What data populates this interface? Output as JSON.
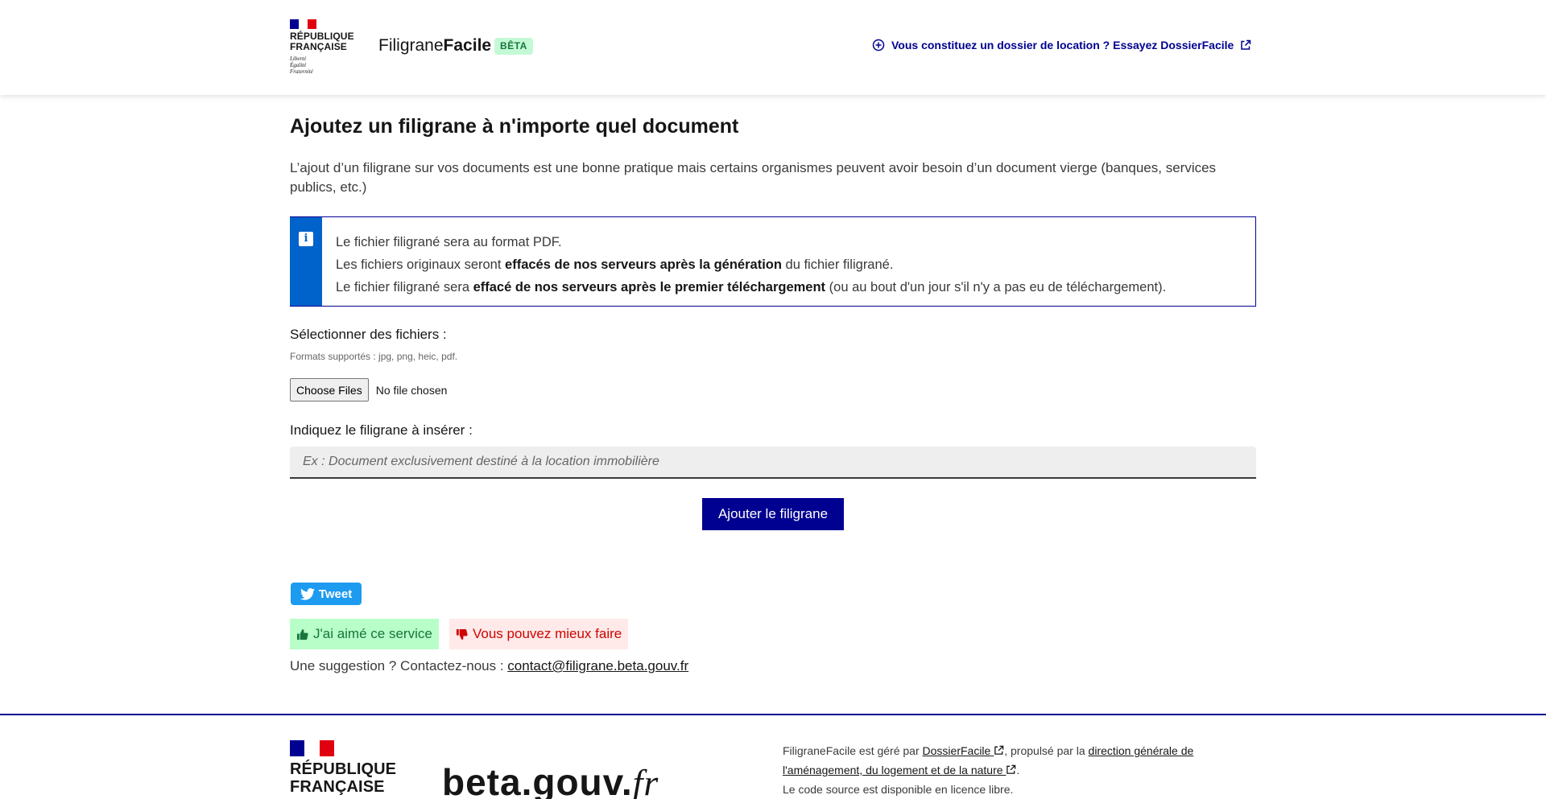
{
  "header": {
    "republic_name_line1": "RÉPUBLIQUE",
    "republic_name_line2": "FRANÇAISE",
    "motto_line1": "Liberté",
    "motto_line2": "Égalité",
    "motto_line3": "Fraternité",
    "site_title_part1": "Filigrane",
    "site_title_part2": "Facile",
    "badge": "BÊTA",
    "cta_link": "Vous constituez un dossier de location ? Essayez DossierFacile"
  },
  "main": {
    "title": "Ajoutez un filigrane à n'importe quel document",
    "intro": "L’ajout d’un filigrane sur vos documents est une bonne pratique mais certains organismes peuvent avoir besoin d’un document vierge (banques, services publics, etc.)",
    "callout": {
      "line1": "Le fichier filigrané sera au format PDF.",
      "line2_pre": "Les fichiers originaux seront ",
      "line2_bold": "effacés de nos serveurs après la génération",
      "line2_post": " du fichier filigrané.",
      "line3_pre": "Le fichier filigrané sera ",
      "line3_bold": "effacé de nos serveurs après le premier téléchargement",
      "line3_post": " (ou au bout d'un jour s'il n'y a pas eu de téléchargement)."
    },
    "files_label": "Sélectionner des fichiers :",
    "files_hint": "Formats supportés : jpg, png, heic, pdf.",
    "file_button": "Choose Files",
    "file_status": "No file chosen",
    "watermark_label": "Indiquez le filigrane à insérer :",
    "watermark_placeholder": "Ex : Document exclusivement destiné à la location immobilière",
    "submit": "Ajouter le filigrane",
    "tweet": "Tweet",
    "feedback_good": "J'ai aimé ce service",
    "feedback_bad": "Vous pouvez mieux faire",
    "suggestion_text": "Une suggestion ? Contactez-nous : ",
    "suggestion_email": "contact@filigrane.beta.gouv.fr"
  },
  "footer": {
    "republic_name_line1": "RÉPUBLIQUE",
    "republic_name_line2": "FRANÇAISE",
    "beta_logo_main": "beta.gouv.",
    "beta_logo_suffix": "fr",
    "managed_pre": "FiligraneFacile est géré par ",
    "managed_link": "DossierFacile",
    "powered_pre": ", propulsé par la ",
    "powered_link": "direction générale de l'aménagement, du logement et de la nature",
    "powered_post": ".",
    "source_code": "Le code source est disponible en licence libre."
  },
  "colors": {
    "primary": "#000091",
    "info": "#0063cb",
    "success_bg": "#b8fec9",
    "error_bg": "#ffe9e9",
    "twitter": "#1d9bf0"
  }
}
